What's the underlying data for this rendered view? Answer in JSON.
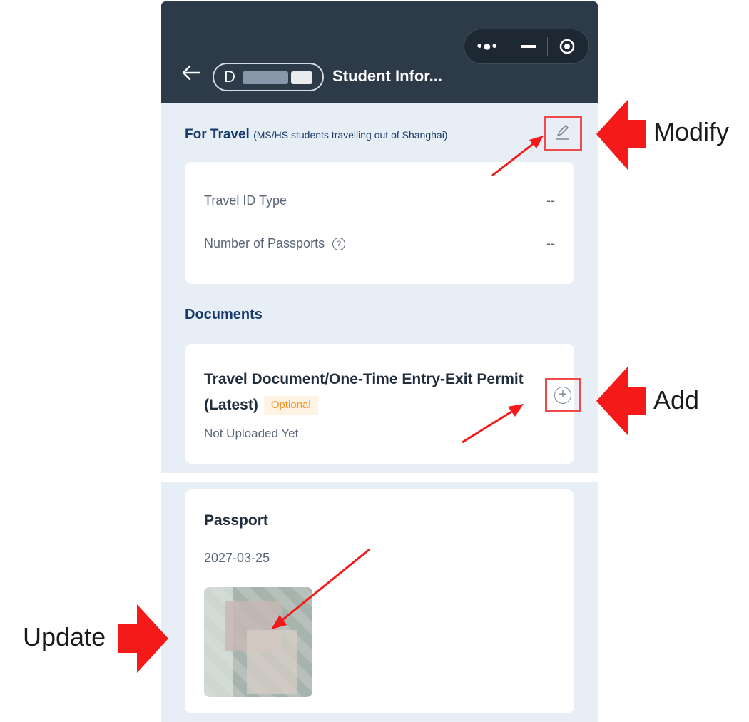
{
  "header": {
    "back_icon": "arrow-left-icon",
    "name_prefix": "D",
    "title": "Student Infor...",
    "capsule": {
      "more_icon": "more-dots-icon",
      "minimize_icon": "minimize-icon",
      "close_icon": "target-icon"
    }
  },
  "travel": {
    "heading": "For Travel",
    "subheading": "(MS/HS students travelling out of Shanghai)",
    "edit_icon": "pencil-icon",
    "rows": [
      {
        "label": "Travel ID Type",
        "value": "--"
      },
      {
        "label": "Number of Passports",
        "value": "--",
        "help_icon": "help-circle-icon"
      }
    ]
  },
  "documents": {
    "heading": "Documents",
    "item": {
      "title": "Travel Document/One-Time Entry-Exit Permit (Latest)",
      "tag": "Optional",
      "status": "Not Uploaded Yet",
      "add_icon": "plus-circle-icon"
    }
  },
  "passport": {
    "title": "Passport",
    "date": "2027-03-25"
  },
  "annotations": {
    "modify": "Modify",
    "add": "Add",
    "update": "Update",
    "highlight_color": "#ef4a4a",
    "arrow_color": "#f51a1a"
  }
}
